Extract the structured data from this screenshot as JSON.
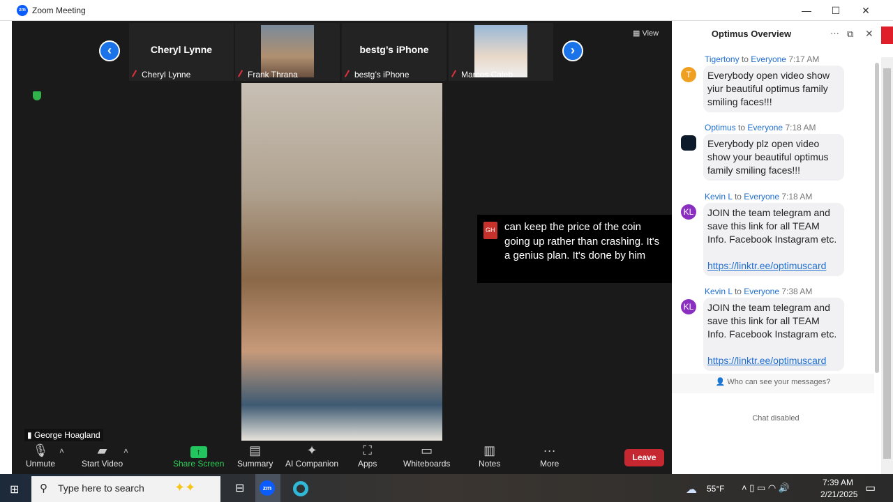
{
  "window": {
    "title": "Zoom Meeting",
    "minimize": "—",
    "maximize": "☐",
    "close": "✕"
  },
  "strip": {
    "tiles": [
      {
        "name": "Cheryl Lynne",
        "label": "Cheryl Lynne"
      },
      {
        "name": "",
        "label": "Frank Thrana"
      },
      {
        "name": "bestg’s iPhone",
        "label": "bestg’s iPhone"
      },
      {
        "name": "",
        "label": "Marcos Caleb"
      }
    ],
    "prev": "‹",
    "next": "›",
    "view": "View"
  },
  "speaker": {
    "name": "George Hoagland"
  },
  "caption": {
    "initials": "GH",
    "text": "can keep the price of the coin going up rather than crashing. It's a genius plan. It's done by him"
  },
  "toolbar": {
    "unmute": "Unmute",
    "start_video": "Start Video",
    "share": "Share Screen",
    "summary": "Summary",
    "ai": "AI Companion",
    "apps": "Apps",
    "whiteboards": "Whiteboards",
    "notes": "Notes",
    "more": "More",
    "leave": "Leave"
  },
  "chat": {
    "title": "Optimus Overview",
    "who": "Who can see your messages?",
    "disabled": "Chat disabled",
    "messages": [
      {
        "from": "Tigertony",
        "to": "to",
        "audience": "Everyone",
        "time": "7:17 AM",
        "avatar": "T",
        "avatar_color": "#f0a020",
        "text": "Everybody open video show yiur beautiful optimus family smiling faces!!!",
        "link": ""
      },
      {
        "from": "Optimus",
        "to": "to",
        "audience": "Everyone",
        "time": "7:18 AM",
        "avatar": "",
        "avatar_color": "#0d1a2a",
        "text": "Everybody plz open video show your  beautiful optimus family smiling faces!!!",
        "link": ""
      },
      {
        "from": "Kevin L",
        "to": "to",
        "audience": "Everyone",
        "time": "7:18 AM",
        "avatar": "KL",
        "avatar_color": "#8a2fc0",
        "text": "JOIN the team telegram and save this link for all TEAM Info. Facebook Instagram etc.",
        "link": "https://linktr.ee/optimuscard"
      },
      {
        "from": "Kevin L",
        "to": "to",
        "audience": "Everyone",
        "time": "7:38 AM",
        "avatar": "KL",
        "avatar_color": "#8a2fc0",
        "text": "JOIN the team telegram and save this link for all TEAM Info. Facebook Instagram etc.",
        "link": "https://linktr.ee/optimuscard"
      }
    ]
  },
  "taskbar": {
    "search_placeholder": "Type here to search",
    "weather": "55°F",
    "time": "7:39 AM",
    "date": "2/21/2025",
    "zoom_app": "zm"
  }
}
